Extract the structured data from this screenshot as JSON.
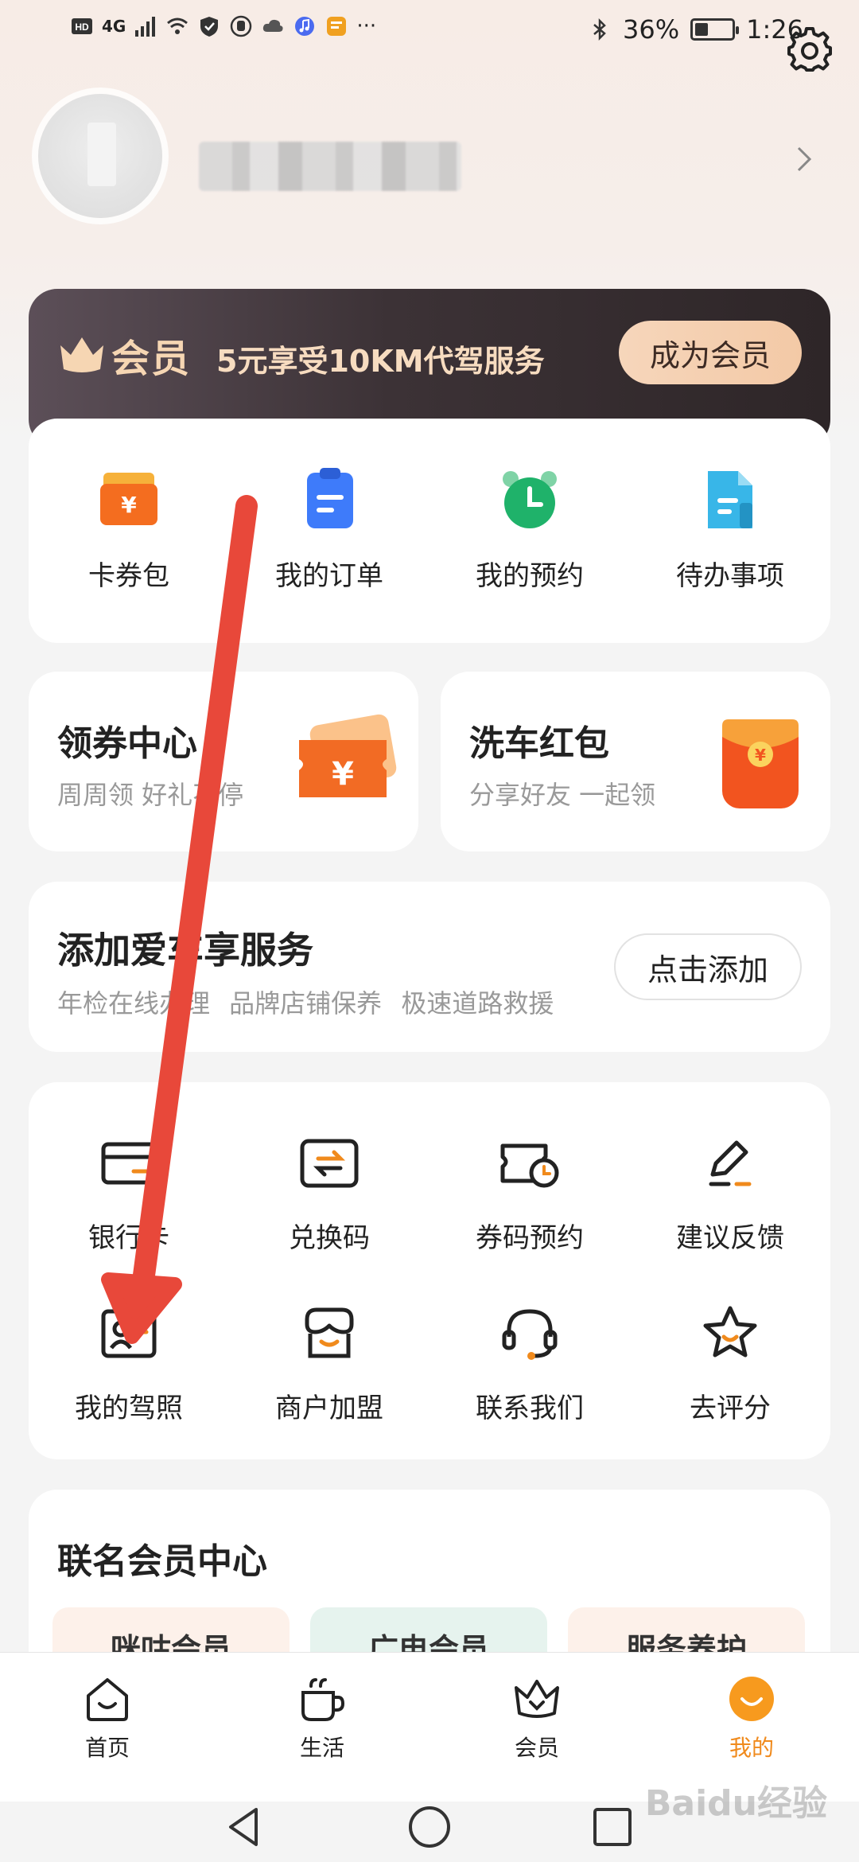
{
  "status_bar": {
    "network": "4G",
    "battery": "36%",
    "battery_level": 0.36,
    "time": "1:26"
  },
  "member_banner": {
    "title": "会员",
    "description": "5元享受10KM代驾服务",
    "cta": "成为会员"
  },
  "quick_actions": [
    {
      "label": "卡券包",
      "icon": "coupon-wallet-icon"
    },
    {
      "label": "我的订单",
      "icon": "order-list-icon"
    },
    {
      "label": "我的预约",
      "icon": "alarm-clock-icon"
    },
    {
      "label": "待办事项",
      "icon": "todo-doc-icon"
    }
  ],
  "promos": [
    {
      "title": "领券中心",
      "subtitle": "周周领 好礼不停",
      "icon": "coupon-ticket-icon"
    },
    {
      "title": "洗车红包",
      "subtitle": "分享好友 一起领",
      "icon": "red-envelope-icon"
    }
  ],
  "car_service": {
    "title": "添加爱车享服务",
    "subtitle": "年检在线办理 品牌店铺保养 极速道路救援",
    "button": "点击添加"
  },
  "tools": [
    {
      "label": "银行卡",
      "icon": "bank-card-icon"
    },
    {
      "label": "兑换码",
      "icon": "exchange-code-icon"
    },
    {
      "label": "券码预约",
      "icon": "coupon-booking-icon"
    },
    {
      "label": "建议反馈",
      "icon": "feedback-pen-icon"
    },
    {
      "label": "我的驾照",
      "icon": "driver-license-icon"
    },
    {
      "label": "商户加盟",
      "icon": "shop-icon"
    },
    {
      "label": "联系我们",
      "icon": "headset-icon"
    },
    {
      "label": "去评分",
      "icon": "star-icon"
    }
  ],
  "cobrand": {
    "title": "联名会员中心",
    "cards": [
      {
        "label": "咪咕会员",
        "color": "#fdf1ea"
      },
      {
        "label": "广电会员",
        "color": "#e6f3ee"
      },
      {
        "label": "服务养护",
        "color": "#fdf1ea"
      }
    ]
  },
  "tabbar": [
    {
      "label": "首页",
      "icon": "home-icon"
    },
    {
      "label": "生活",
      "icon": "cup-icon"
    },
    {
      "label": "会员",
      "icon": "crown-icon"
    },
    {
      "label": "我的",
      "icon": "profile-smile-icon",
      "active": true
    }
  ],
  "watermark": "Baidu经验",
  "colors": {
    "accent": "#f08a1c",
    "member_dark": "#3c3236",
    "annotation_arrow": "#e8483a"
  }
}
